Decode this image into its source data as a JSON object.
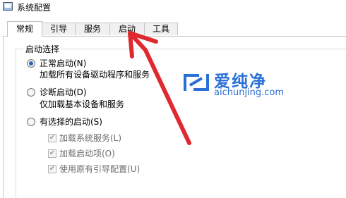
{
  "window": {
    "title": "系统配置",
    "icon": "system-config-icon"
  },
  "tabs": [
    {
      "label": "常规",
      "active": true
    },
    {
      "label": "引导",
      "active": false
    },
    {
      "label": "服务",
      "active": false
    },
    {
      "label": "启动",
      "active": false
    },
    {
      "label": "工具",
      "active": false
    }
  ],
  "startup_group": {
    "legend": "启动选择",
    "options": [
      {
        "label": "正常启动(N)",
        "description": "加载所有设备驱动程序和服务",
        "selected": true
      },
      {
        "label": "诊断启动(D)",
        "description": "仅加载基本设备和服务",
        "selected": false
      },
      {
        "label": "有选择的启动(S)",
        "selected": false
      }
    ],
    "selective_items": [
      {
        "label": "加载系统服务(L)",
        "checked": true,
        "enabled": false
      },
      {
        "label": "加载启动项(O)",
        "checked": true,
        "enabled": false
      },
      {
        "label": "使用原有引导配置(U)",
        "checked": true,
        "enabled": false
      }
    ]
  },
  "watermark": {
    "name": "爱纯净",
    "url": "aichunjing.com",
    "color": "#2a6fd6"
  },
  "annotation": {
    "arrow_color": "#e0282f",
    "points_to": "启动"
  }
}
